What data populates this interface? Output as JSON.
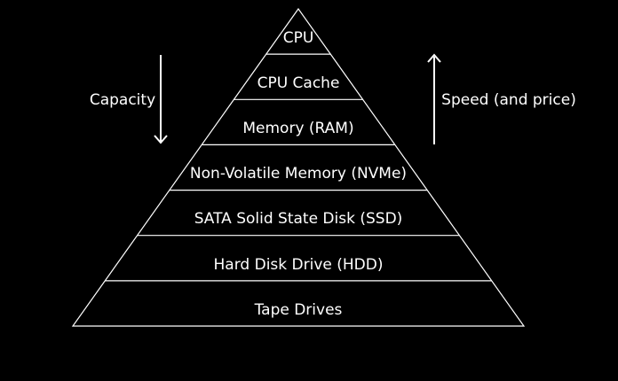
{
  "colors": {
    "background": "#000000",
    "foreground": "#ffffff"
  },
  "pyramid": {
    "tiers": [
      {
        "label": "CPU"
      },
      {
        "label": "CPU Cache"
      },
      {
        "label": "Memory (RAM)"
      },
      {
        "label": "Non-Volatile Memory (NVMe)"
      },
      {
        "label": "SATA Solid State Disk (SSD)"
      },
      {
        "label": "Hard Disk Drive (HDD)"
      },
      {
        "label": "Tape Drives"
      }
    ]
  },
  "left_indicator": {
    "label": "Capacity",
    "direction": "down"
  },
  "right_indicator": {
    "label": "Speed (and price)",
    "direction": "up"
  }
}
